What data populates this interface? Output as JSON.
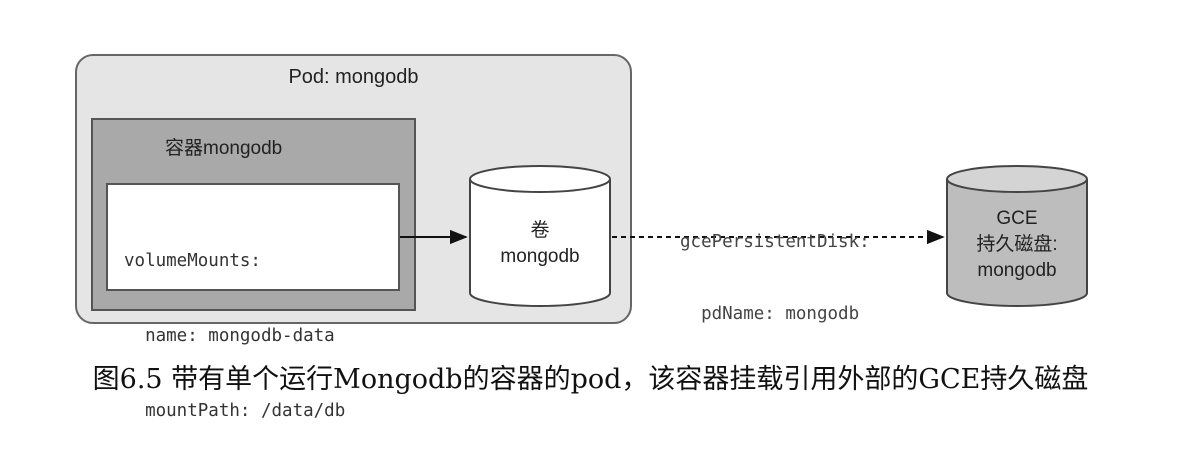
{
  "pod": {
    "label": "Pod: mongodb"
  },
  "container": {
    "label": "容器mongodb",
    "code_lines": [
      "volumeMounts:",
      "  name: mongodb-data",
      "  mountPath: /data/db"
    ]
  },
  "volume": {
    "line1": "卷",
    "line2": "mongodb"
  },
  "connector": {
    "line1": "gcePersistentDisk:",
    "line2": "  pdName: mongodb"
  },
  "gce_disk": {
    "line1": "GCE",
    "line2": "持久磁盘:",
    "line3": "mongodb"
  },
  "caption": "图6.5 带有单个运行Mongodb的容器的pod，该容器挂载引用外部的GCE持久磁盘"
}
